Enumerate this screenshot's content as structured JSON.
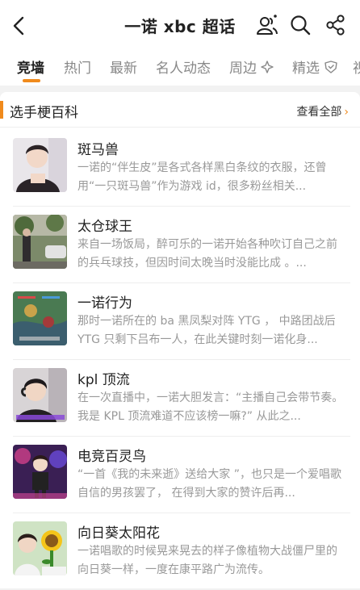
{
  "header": {
    "title": "一诺 xbc 超话"
  },
  "tabs": [
    {
      "label": "竞墙",
      "active": true
    },
    {
      "label": "热门"
    },
    {
      "label": "最新"
    },
    {
      "label": "名人动态"
    },
    {
      "label": "周边",
      "icon": "sparkle-icon"
    },
    {
      "label": "精选",
      "icon": "badge-icon"
    },
    {
      "label": "视"
    }
  ],
  "section": {
    "title": "选手梗百科",
    "see_all": "查看全部",
    "see_all_arrow": "›"
  },
  "items": [
    {
      "title": "斑马兽",
      "desc": "一诺的“伴生皮”是各式各样黑白条纹的衣服，还曾用“一只斑马兽”作为游戏 id，很多粉丝相关..."
    },
    {
      "title": "太仓球王",
      "desc": "来自一场饭局，醉可乐的一诺开始各种吹订自己之前的兵乓球技，但因时间太晚当时没能比成 。..."
    },
    {
      "title": "一诺行为",
      "desc": "那时一诺所在的 ba 黑凤梨对阵 YTG ， 中路团战后 YTG 只剩下吕布一人，在此关键时刻一诺化身..."
    },
    {
      "title": "kpl 顶流",
      "desc": "在一次直播中，一诺大胆发言：“主播自己会带节奏。我是 KPL 顶流难道不应该榜一嘛?” 从此之..."
    },
    {
      "title": "电竞百灵鸟",
      "desc": "“一首《我的未来逝》送给大家 ”，也只是一个爱唱歌自信的男孩罢了， 在得到大家的赞许后再..."
    },
    {
      "title": "向日葵太阳花",
      "desc": "一诺唱歌的时候晃来晃去的样子像植物大战僵尸里的向日葵一样，一度在康平路广为流传。"
    }
  ],
  "colors": {
    "accent": "#f08a1c"
  }
}
